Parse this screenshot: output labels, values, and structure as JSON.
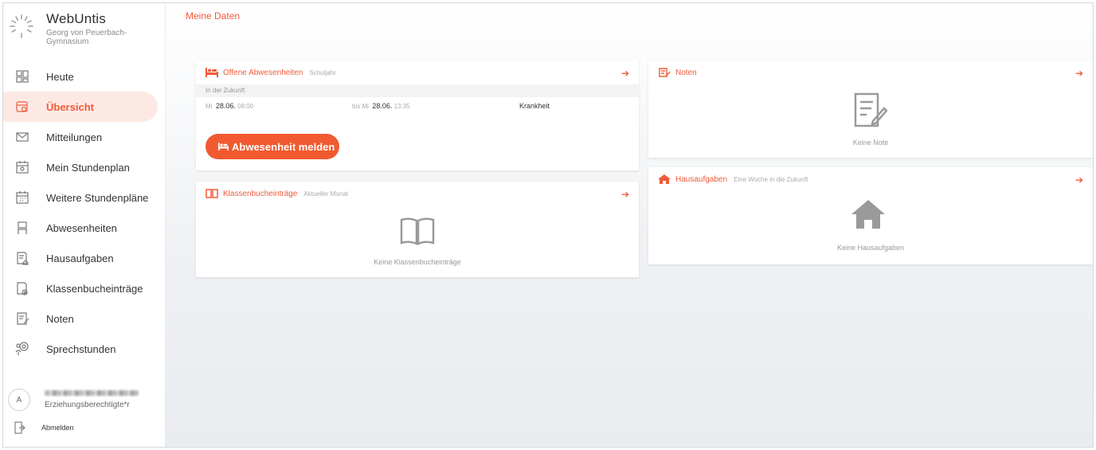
{
  "brand": {
    "name": "WebUntis",
    "school": "Georg von Peuerbach-Gymnasium"
  },
  "nav": {
    "items": [
      {
        "label": "Heute",
        "icon": "grid-icon"
      },
      {
        "label": "Übersicht",
        "icon": "overview-icon",
        "active": true
      },
      {
        "label": "Mitteilungen",
        "icon": "mail-icon"
      },
      {
        "label": "Mein Stundenplan",
        "icon": "calendar-user-icon"
      },
      {
        "label": "Weitere Stundenpläne",
        "icon": "calendar-grid-icon"
      },
      {
        "label": "Abwesenheiten",
        "icon": "bed-icon"
      },
      {
        "label": "Hausaufgaben",
        "icon": "homework-icon"
      },
      {
        "label": "Klassenbucheinträge",
        "icon": "classbook-icon"
      },
      {
        "label": "Noten",
        "icon": "grade-icon"
      },
      {
        "label": "Sprechstunden",
        "icon": "consultation-icon"
      }
    ]
  },
  "user": {
    "avatar_letter": "A",
    "role": "Erziehungsberechtigte*r",
    "logout_label": "Abmelden"
  },
  "main": {
    "page_title": "Meine Daten",
    "absences": {
      "title": "Offene Abwesenheiten",
      "subtitle": "Schuljahr",
      "section": "In der Zukunft",
      "row": {
        "from_day": "Mi",
        "from_date": "28.06.",
        "from_time": "08:00",
        "to_prefix": "bis Mi",
        "to_date": "28.06.",
        "to_time": "13:35",
        "reason": "Krankheit"
      },
      "button_label": "Abwesenheit melden"
    },
    "classbook": {
      "title": "Klassenbucheinträge",
      "subtitle": "Aktueller Monat",
      "empty": "Keine Klassenbucheinträge"
    },
    "grades": {
      "title": "Noten",
      "empty": "Keine Note"
    },
    "homework": {
      "title": "Hausaufgaben",
      "subtitle": "Eine Woche in die Zukunft",
      "empty": "Keine Hausaufgaben"
    },
    "arrow": "➔"
  },
  "colors": {
    "accent": "#f05b3a",
    "button": "#f15a30",
    "active_bg": "#fde9e4"
  }
}
